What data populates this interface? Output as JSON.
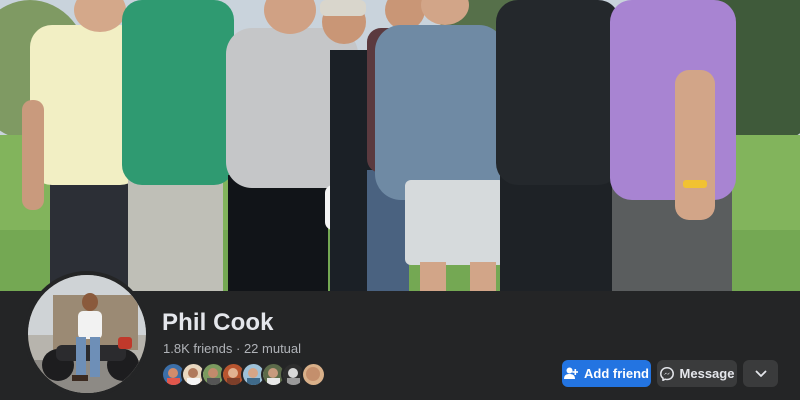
{
  "profile": {
    "name": "Phil Cook",
    "friends_count": "1.8K friends",
    "separator": " · ",
    "mutual_count": "22 mutual"
  },
  "actions": {
    "add_friend_label": "Add friend",
    "message_label": "Message",
    "more_icon": "chevron-down-icon"
  },
  "colors": {
    "primary_button": "#2374e1",
    "secondary_button": "#3a3b3c",
    "background": "#242526",
    "name_text": "#e4e6eb",
    "meta_text": "#b0b3b8"
  },
  "mutual_friend_avatars_shown": 8
}
